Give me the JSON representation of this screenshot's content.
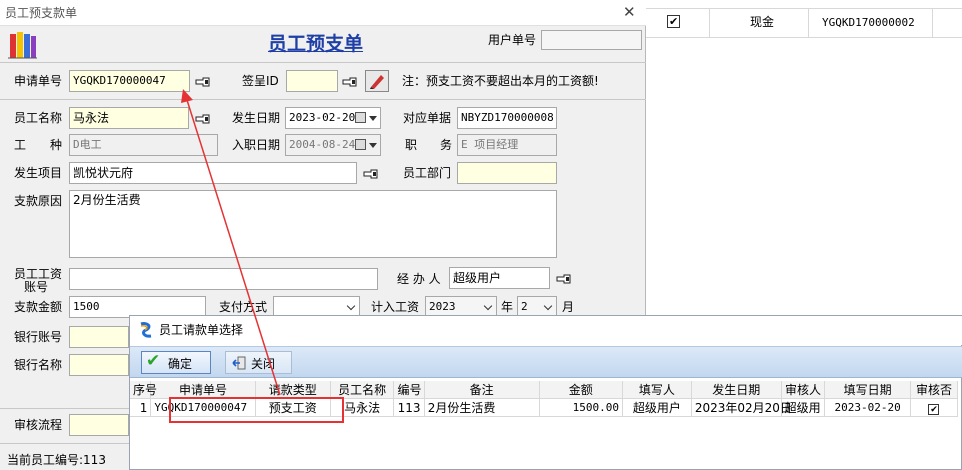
{
  "main_window": {
    "title": "员工预支款单",
    "header_title": "员工预支单",
    "user_no_label": "用户单号",
    "user_no_value": "",
    "note": "注：预支工资不要超出本月的工资额!",
    "current_employee_label": "当前员工编号:113"
  },
  "form": {
    "apply_no": {
      "label": "申请单号",
      "value": "YGQKD170000047"
    },
    "sign_id": {
      "label": "签呈ID",
      "value": ""
    },
    "employee_name": {
      "label": "员工名称",
      "value": "马永法"
    },
    "occur_date": {
      "label": "发生日期",
      "value": "2023-02-20"
    },
    "ref_doc": {
      "label": "对应单据",
      "value": "NBYZD170000008"
    },
    "work_type": {
      "label_a": "工",
      "label_b": "种",
      "value": "D电工"
    },
    "join_date": {
      "label": "入职日期",
      "value": "2004-08-24"
    },
    "position": {
      "label_a": "职",
      "label_b": "务",
      "value": "E 项目经理"
    },
    "project": {
      "label": "发生项目",
      "value": "凯悦状元府"
    },
    "department": {
      "label": "员工部门",
      "value": ""
    },
    "reason": {
      "label": "支款原因",
      "value": "2月份生活费"
    },
    "salary_account": {
      "label_a": "员工工资",
      "label_b": "账号",
      "value": ""
    },
    "handler": {
      "label": "经 办 人",
      "value": "超级用户"
    },
    "amount": {
      "label": "支款金额",
      "value": "1500"
    },
    "pay_method": {
      "label": "支付方式",
      "value": ""
    },
    "salary_year": {
      "label": "计入工资",
      "value": "2023",
      "year_unit": "年"
    },
    "salary_month": {
      "value": "2",
      "unit": "月"
    },
    "bank_account": {
      "label": "银行账号"
    },
    "bank_name": {
      "label": "银行名称"
    },
    "review_flow": {
      "label": "审核流程"
    }
  },
  "background_row": {
    "checked": true,
    "method": "现金",
    "doc_no": "YGQKD170000002"
  },
  "dialog": {
    "title": "员工请款单选择",
    "confirm_label": "确定",
    "close_label": "关闭",
    "columns": [
      "序号",
      "申请单号",
      "请款类型",
      "员工名称",
      "编号",
      "备注",
      "金额",
      "填写人",
      "发生日期",
      "审核人",
      "填写日期",
      "审核否"
    ],
    "rows": [
      {
        "seq": "1",
        "apply_no": "YGQKD170000047",
        "type": "预支工资",
        "name": "马永法",
        "code": "113",
        "remark": "2月份生活费",
        "amount": "1500.00",
        "filler": "超级用户",
        "occur_date": "2023年02月20日",
        "reviewer": "超级用",
        "fill_date": "2023-02-20",
        "reviewed": true
      }
    ]
  },
  "colors": {
    "title_blue": "#1e3fa6",
    "highlight_red": "#e53333",
    "field_yellow": "#ffffe1",
    "toolbar_blue": "#c9ddf3"
  }
}
